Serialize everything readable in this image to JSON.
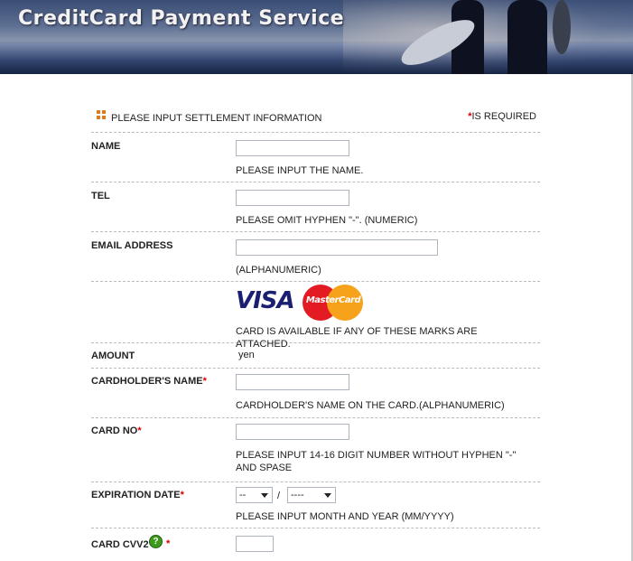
{
  "header": {
    "title": "CreditCard Payment Service"
  },
  "form": {
    "heading": "PLEASE INPUT SETTLEMENT INFORMATION",
    "required_note": "IS REQUIRED",
    "required_star": "*",
    "name": {
      "label": "NAME",
      "value": "",
      "hint": "PLEASE INPUT THE NAME."
    },
    "tel": {
      "label": "TEL",
      "value": "",
      "hint": "PLEASE OMIT HYPHEN \"-\". (NUMERIC)"
    },
    "email": {
      "label": "EMAIL ADDRESS",
      "value": "",
      "hint": "(ALPHANUMERIC)"
    },
    "cards": {
      "visa": "VISA",
      "mastercard": "MasterCard",
      "hint": "CARD IS AVAILABLE IF ANY OF THESE MARKS ARE ATTACHED."
    },
    "amount": {
      "label": "AMOUNT",
      "value": "yen"
    },
    "cardholder": {
      "label": "CARDHOLDER'S NAME",
      "value": "",
      "hint": "CARDHOLDER'S NAME ON THE CARD.(ALPHANUMERIC)"
    },
    "card_no": {
      "label": "CARD NO",
      "value": "",
      "hint": "PLEASE INPUT 14-16 DIGIT NUMBER WITHOUT HYPHEN \"-\" AND SPASE"
    },
    "expiration": {
      "label": "EXPIRATION DATE",
      "month": "--",
      "separator": "/",
      "year": "----",
      "hint": "PLEASE INPUT MONTH AND YEAR (MM/YYYY)"
    },
    "cvv": {
      "label": "CARD CVV2",
      "help": "?",
      "value": ""
    }
  },
  "colors": {
    "accent": "#e07a1b",
    "required": "#d40000",
    "visa": "#1a1f71",
    "mc_red": "#e31b23",
    "mc_orange": "#f7a21b"
  }
}
